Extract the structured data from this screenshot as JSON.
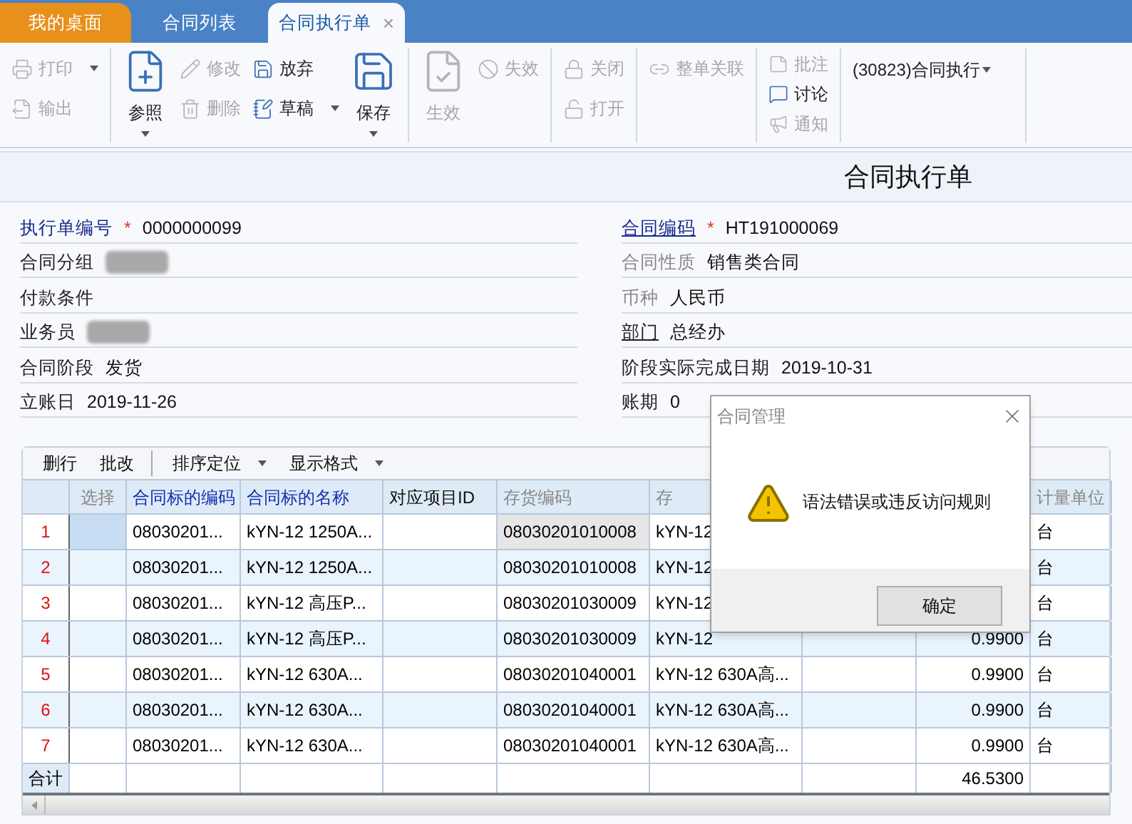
{
  "tabs": [
    {
      "label": "我的桌面",
      "kind": "home",
      "selected": false,
      "closable": false
    },
    {
      "label": "合同列表",
      "kind": "page",
      "selected": false,
      "closable": false
    },
    {
      "label": "合同执行单",
      "kind": "page",
      "selected": true,
      "closable": true
    }
  ],
  "close_glyph": "×",
  "toolbar": [
    {
      "items": [
        {
          "label": "打印",
          "kind": "small",
          "disabled": true,
          "dropdown": true
        },
        {
          "label": "输出",
          "kind": "small",
          "disabled": true,
          "dropdown": false
        }
      ]
    },
    {
      "items": [
        {
          "label": "参照",
          "kind": "large",
          "disabled": false,
          "dropdown": true
        },
        {
          "label": "修改",
          "kind": "small",
          "disabled": true,
          "dropdown": false
        },
        {
          "label": "删除",
          "kind": "small",
          "disabled": true,
          "dropdown": false
        },
        {
          "label": "放弃",
          "kind": "small",
          "disabled": false,
          "dropdown": false
        },
        {
          "label": "草稿",
          "kind": "small",
          "disabled": false,
          "dropdown": true
        },
        {
          "label": "保存",
          "kind": "large",
          "disabled": false,
          "dropdown": true
        }
      ]
    },
    {
      "items": [
        {
          "label": "生效",
          "kind": "large",
          "disabled": true,
          "dropdown": false
        },
        {
          "label": "失效",
          "kind": "small",
          "disabled": true,
          "dropdown": false
        }
      ]
    },
    {
      "items": [
        {
          "label": "关闭",
          "kind": "small",
          "disabled": true,
          "dropdown": false
        },
        {
          "label": "打开",
          "kind": "small",
          "disabled": true,
          "dropdown": false
        }
      ]
    },
    {
      "items": [
        {
          "label": "整单关联",
          "kind": "small",
          "disabled": true,
          "dropdown": false
        }
      ]
    },
    {
      "items": [
        {
          "label": "批注",
          "kind": "tiny",
          "disabled": true,
          "dropdown": false
        },
        {
          "label": "讨论",
          "kind": "tiny",
          "disabled": false,
          "dropdown": false
        },
        {
          "label": "通知",
          "kind": "tiny",
          "disabled": true,
          "dropdown": false
        }
      ]
    },
    {
      "items": [
        {
          "label": "(30823)合同执行",
          "kind": "menu",
          "disabled": false,
          "dropdown": true
        }
      ]
    }
  ],
  "form_title": "合同执行单",
  "form": {
    "left": [
      {
        "label": "执行单编号",
        "kind": "link",
        "required": true,
        "value": "0000000099",
        "redacted": false
      },
      {
        "label": "合同分组",
        "kind": "plain",
        "required": false,
        "redacted": true
      },
      {
        "label": "付款条件",
        "kind": "plain",
        "required": false,
        "redacted": false
      },
      {
        "label": "业务员",
        "kind": "plain",
        "required": false,
        "redacted": true
      },
      {
        "label": "合同阶段",
        "kind": "plain",
        "required": false,
        "value": "发货",
        "redacted": false
      },
      {
        "label": "立账日",
        "kind": "plain",
        "required": false,
        "value": "2019-11-26",
        "redacted": false
      }
    ],
    "right": [
      {
        "label": "合同编码",
        "kind": "underlined-link",
        "required": true,
        "value": "HT191000069",
        "redacted": false
      },
      {
        "label": "合同性质",
        "kind": "readonly",
        "required": false,
        "value": "销售类合同",
        "redacted": false
      },
      {
        "label": "币种",
        "kind": "readonly",
        "required": false,
        "value": "人民币",
        "redacted": false
      },
      {
        "label": "部门",
        "kind": "underlined",
        "required": false,
        "value": "总经办",
        "redacted": false
      },
      {
        "label": "阶段实际完成日期",
        "kind": "plain",
        "required": false,
        "value": "2019-10-31",
        "redacted": false
      },
      {
        "label": "账期",
        "kind": "plain",
        "required": false,
        "value": "0",
        "redacted": false
      }
    ]
  },
  "required_mark": "*",
  "grid_toolbar": [
    {
      "label": "删行",
      "dropdown": false,
      "separator_after": false
    },
    {
      "label": "批改",
      "dropdown": false,
      "separator_after": true
    },
    {
      "label": "排序定位",
      "dropdown": true,
      "separator_after": false
    },
    {
      "label": "显示格式",
      "dropdown": true,
      "separator_after": false
    }
  ],
  "table": {
    "columns": [
      {
        "label": "选择",
        "kind": "readonly"
      },
      {
        "label": "合同标的编码",
        "kind": "link"
      },
      {
        "label": "合同标的名称",
        "kind": "link"
      },
      {
        "label": "对应项目ID",
        "kind": "plain"
      },
      {
        "label": "存货编码",
        "kind": "readonly"
      },
      {
        "label": "存",
        "kind": "readonly"
      },
      {
        "kind": "readonly"
      },
      {
        "kind": "number"
      },
      {
        "label": "计量单位",
        "kind": "readonly"
      }
    ],
    "rows": [
      {
        "number": "1",
        "current": true,
        "item_code": "08030201...",
        "item_name": "kYN-12 1250A...",
        "inventory_code": "08030201010008",
        "column_6": "kYN-12",
        "unit": "台"
      },
      {
        "number": "2",
        "current": false,
        "item_code": "08030201...",
        "item_name": "kYN-12 1250A...",
        "inventory_code": "08030201010008",
        "column_6": "kYN-12",
        "unit": "台"
      },
      {
        "number": "3",
        "current": false,
        "item_code": "08030201...",
        "item_name": "kYN-12 高压P...",
        "inventory_code": "08030201030009",
        "column_6": "kYN-12",
        "unit": "台"
      },
      {
        "number": "4",
        "current": false,
        "item_code": "08030201...",
        "item_name": "kYN-12 高压P...",
        "inventory_code": "08030201030009",
        "column_6": "kYN-12",
        "column_8": "0.9900",
        "unit": "台"
      },
      {
        "number": "5",
        "current": false,
        "item_code": "08030201...",
        "item_name": "kYN-12 630A...",
        "inventory_code": "08030201040001",
        "column_6": "kYN-12 630A高...",
        "column_8": "0.9900",
        "unit": "台"
      },
      {
        "number": "6",
        "current": false,
        "item_code": "08030201...",
        "item_name": "kYN-12 630A...",
        "inventory_code": "08030201040001",
        "column_6": "kYN-12 630A高...",
        "column_8": "0.9900",
        "unit": "台"
      },
      {
        "number": "7",
        "current": false,
        "item_code": "08030201...",
        "item_name": "kYN-12 630A...",
        "inventory_code": "08030201040001",
        "column_6": "kYN-12 630A高...",
        "column_8": "0.9900",
        "unit": "台"
      }
    ],
    "total": {
      "label": "合计",
      "column_8": "46.5300"
    }
  },
  "dialog": {
    "title": "合同管理",
    "message": "语法错误或违反访问规则",
    "button": "确定"
  }
}
